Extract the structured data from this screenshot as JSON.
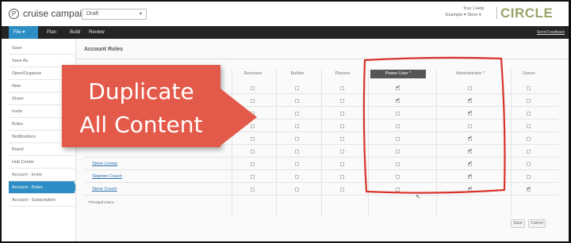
{
  "header": {
    "app_title": "cruise campaign",
    "status_value": "Draft",
    "top_links_row1": "Tour | Help",
    "top_links_row2": "Example ▾   Store ▾",
    "brand": "CIRCLE"
  },
  "nav": {
    "file": "File",
    "items": [
      "Plan",
      "Build",
      "Review"
    ],
    "feedback": "Send Feedback"
  },
  "sidebar": {
    "items": [
      "Save",
      "Save As",
      "Open/Organize",
      "New",
      "Share",
      "Invite",
      "Roles",
      "Notifications",
      "Brand",
      "Hub Center",
      "Account - Invite",
      "Account - Roles",
      "Account - Subscription"
    ],
    "active_index": 11
  },
  "main": {
    "title": "Account Roles",
    "columns": [
      "Reviewer",
      "Builder",
      "Planner",
      "Power User *",
      "Administrator *",
      "Owner"
    ],
    "highlight_column_index": 3,
    "rows": [
      {
        "name": "",
        "checks": [
          false,
          false,
          false,
          true,
          false,
          false
        ]
      },
      {
        "name": "",
        "checks": [
          false,
          false,
          false,
          true,
          true,
          false
        ]
      },
      {
        "name": "",
        "checks": [
          false,
          false,
          false,
          false,
          true,
          false
        ]
      },
      {
        "name": "",
        "checks": [
          false,
          false,
          false,
          false,
          false,
          false
        ]
      },
      {
        "name": "",
        "checks": [
          false,
          false,
          false,
          false,
          true,
          false
        ]
      },
      {
        "name": "",
        "checks": [
          false,
          false,
          false,
          false,
          true,
          false
        ]
      },
      {
        "name": "Steve Lomas",
        "checks": [
          false,
          false,
          false,
          false,
          true,
          false
        ]
      },
      {
        "name": "Stephen Couch",
        "checks": [
          false,
          false,
          false,
          false,
          true,
          false
        ]
      },
      {
        "name": "Steve Couch",
        "checks": [
          false,
          false,
          false,
          false,
          true,
          true
        ]
      }
    ],
    "footnote": "*Principal Users.",
    "save_label": "Save",
    "cancel_label": "Cancel"
  },
  "callout": {
    "line1": "Duplicate",
    "line2": "All Content",
    "color": "#e45a4a"
  },
  "colors": {
    "accent": "#2d8ec6",
    "nav_bg": "#222426",
    "annotation": "#d9332b"
  }
}
